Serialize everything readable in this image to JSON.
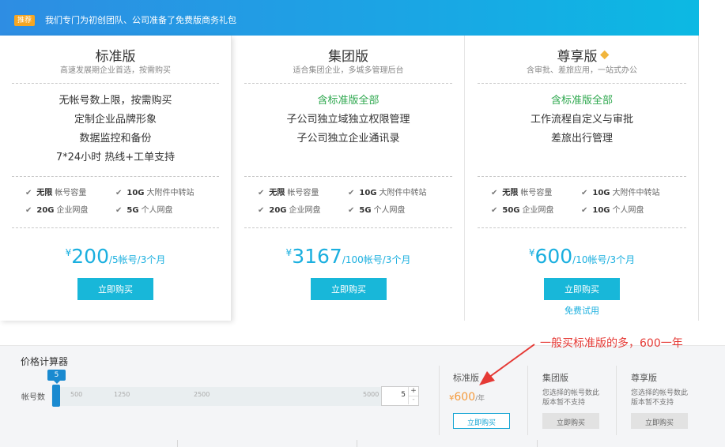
{
  "banner": {
    "tag": "推荐",
    "message": "我们专门为初创团队、公司准备了免费版商务礼包"
  },
  "plans": [
    {
      "name": "标准版",
      "subtitle": "高速发展期企业首选，按需购买",
      "features": [
        {
          "text": "无帐号数上限，按需购买",
          "highlight": false
        },
        {
          "text": "定制企业品牌形象",
          "highlight": false
        },
        {
          "text": "数据监控和备份",
          "highlight": false
        },
        {
          "text": "7*24小时 热线+工单支持",
          "highlight": false
        }
      ],
      "specs": [
        {
          "bold": "无限",
          "text": "帐号容量"
        },
        {
          "bold": "10G",
          "text": "大附件中转站"
        },
        {
          "bold": "20G",
          "text": "企业网盘"
        },
        {
          "bold": "5G",
          "text": "个人网盘"
        }
      ],
      "price": {
        "currency": "¥",
        "amount": "200",
        "unit": "/5帐号/3个月"
      },
      "buy_label": "立即购买"
    },
    {
      "name": "集团版",
      "subtitle": "适合集团企业，多城多管理后台",
      "features": [
        {
          "text": "含标准版全部",
          "highlight": true
        },
        {
          "text": "子公司独立域独立权限管理",
          "highlight": false
        },
        {
          "text": "子公司独立企业通讯录",
          "highlight": false
        }
      ],
      "specs": [
        {
          "bold": "无限",
          "text": "帐号容量"
        },
        {
          "bold": "10G",
          "text": "大附件中转站"
        },
        {
          "bold": "20G",
          "text": "企业网盘"
        },
        {
          "bold": "5G",
          "text": "个人网盘"
        }
      ],
      "price": {
        "currency": "¥",
        "amount": "3167",
        "unit": "/100帐号/3个月"
      },
      "buy_label": "立即购买"
    },
    {
      "name": "尊享版",
      "subtitle": "含审批、差旅应用，一站式办公",
      "features": [
        {
          "text": "含标准版全部",
          "highlight": true
        },
        {
          "text": "工作流程自定义与审批",
          "highlight": false
        },
        {
          "text": "差旅出行管理",
          "highlight": false
        }
      ],
      "specs": [
        {
          "bold": "无限",
          "text": "帐号容量"
        },
        {
          "bold": "10G",
          "text": "大附件中转站"
        },
        {
          "bold": "50G",
          "text": "企业网盘"
        },
        {
          "bold": "10G",
          "text": "个人网盘"
        }
      ],
      "price": {
        "currency": "¥",
        "amount": "600",
        "unit": "/10帐号/3个月"
      },
      "buy_label": "立即购买",
      "trial_label": "免费试用"
    }
  ],
  "calculator": {
    "title": "价格计算器",
    "account_label": "帐号数",
    "slider_value": "5",
    "ticks": [
      "500",
      "1250",
      "2500",
      "5000"
    ],
    "stepper_value": "5",
    "plus": "+",
    "minus": "-",
    "columns": [
      {
        "name": "标准版",
        "currency": "¥",
        "price": "600",
        "per": "/年",
        "button": "立即购买"
      },
      {
        "name": "集团版",
        "note": "您选择的帐号数此版本暂不支持",
        "button": "立即购买"
      },
      {
        "name": "尊享版",
        "note": "您选择的帐号数此版本暂不支持",
        "button": "立即购买"
      }
    ]
  },
  "annotation": {
    "text": "一般买标准版的多，600一年",
    "color": "#e53935"
  },
  "colors": {
    "accent": "#18b7d9",
    "green": "#2fa84f",
    "orange": "#f59a3c",
    "banner_start": "#2e8de3",
    "banner_end": "#0cb9e3"
  }
}
